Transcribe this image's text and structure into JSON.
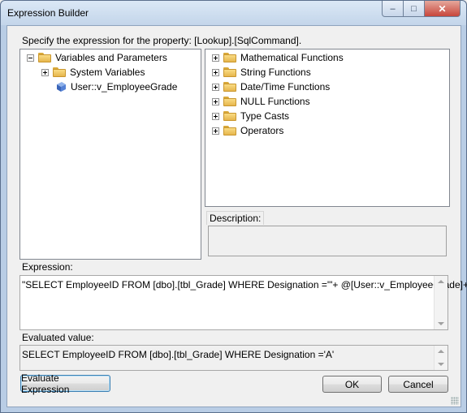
{
  "window": {
    "title": "Expression Builder",
    "close_glyph": "✕",
    "min_glyph": "–",
    "max_glyph": "□"
  },
  "prompt": "Specify the expression for the property: [Lookup].[SqlCommand].",
  "left_tree": {
    "items": [
      {
        "label": "Variables and Parameters",
        "icon": "folder-icon",
        "expander": "minus"
      },
      {
        "label": "System Variables",
        "icon": "folder-icon",
        "expander": "plus"
      },
      {
        "label": "User::v_EmployeeGrade",
        "icon": "variable-icon",
        "expander": "none"
      }
    ]
  },
  "right_tree": {
    "items": [
      {
        "label": "Mathematical Functions",
        "icon": "folder-icon"
      },
      {
        "label": "String Functions",
        "icon": "folder-icon"
      },
      {
        "label": "Date/Time Functions",
        "icon": "folder-icon"
      },
      {
        "label": "NULL Functions",
        "icon": "folder-icon"
      },
      {
        "label": "Type Casts",
        "icon": "folder-icon"
      },
      {
        "label": "Operators",
        "icon": "folder-icon"
      }
    ]
  },
  "description": {
    "label": "Description:",
    "value": ""
  },
  "expression": {
    "label": "Expression:",
    "value": "\"SELECT EmployeeID FROM [dbo].[tbl_Grade] WHERE Designation ='\"+ @[User::v_EmployeeGrade]+\"'\""
  },
  "evaluated": {
    "label": "Evaluated value:",
    "value": "SELECT EmployeeID FROM [dbo].[tbl_Grade] WHERE Designation ='A'"
  },
  "buttons": {
    "evaluate": "Evaluate Expression",
    "ok": "OK",
    "cancel": "Cancel"
  },
  "colors": {
    "title_gradient_top": "#dbe8f6",
    "close_button": "#c7463b",
    "folder": "#f9dc84",
    "variable_icon": "#4a78c9"
  }
}
